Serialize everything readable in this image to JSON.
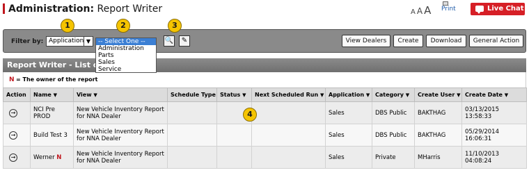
{
  "header": {
    "title_bold": "Administration:",
    "title_rest": "Report Writer",
    "text_sizes": [
      "A",
      "A",
      "A"
    ],
    "print_label": "Print",
    "live_chat_label": "Live Chat"
  },
  "filter": {
    "label": "Filter by:",
    "application_value": "Application",
    "dropdown_options": [
      "-- Select One --",
      "Administration",
      "Parts",
      "Sales",
      "Service"
    ],
    "buttons": [
      "View Dealers",
      "Create",
      "Download",
      "General Action"
    ]
  },
  "callouts": [
    "1",
    "2",
    "3",
    "4"
  ],
  "list": {
    "title": "Report Writer - List of",
    "legend_n": "N",
    "legend_text": "= The owner of the report",
    "columns": [
      "Action",
      "Name",
      "View",
      "Schedule Type",
      "Status",
      "Next Scheduled Run",
      "Application",
      "Category",
      "Create User",
      "Create Date"
    ],
    "rows": [
      {
        "name": "NCI Pre PROD",
        "owner": "",
        "view": "New Vehicle Inventory Report for NNA Dealer",
        "schedule": "",
        "status": "",
        "next_run": "",
        "application": "Sales",
        "category": "DBS Public",
        "create_user": "BAKTHAG",
        "create_date": "03/13/2015 13:58:33"
      },
      {
        "name": "Build Test 3",
        "owner": "",
        "view": "New Vehicle Inventory Report for NNA Dealer",
        "schedule": "",
        "status": "",
        "next_run": "",
        "application": "Sales",
        "category": "DBS Public",
        "create_user": "BAKTHAG",
        "create_date": "05/29/2014 16:06:31"
      },
      {
        "name": "Werner",
        "owner": "N",
        "view": "New Vehicle Inventory Report for NNA Dealer",
        "schedule": "",
        "status": "",
        "next_run": "",
        "application": "Sales",
        "category": "Private",
        "create_user": "MHarris",
        "create_date": "11/10/2013 04:08:24"
      }
    ]
  },
  "colors": {
    "accent_red": "#d61f26",
    "callout_yellow": "#f5c400",
    "selected_blue": "#3b7fd4"
  }
}
